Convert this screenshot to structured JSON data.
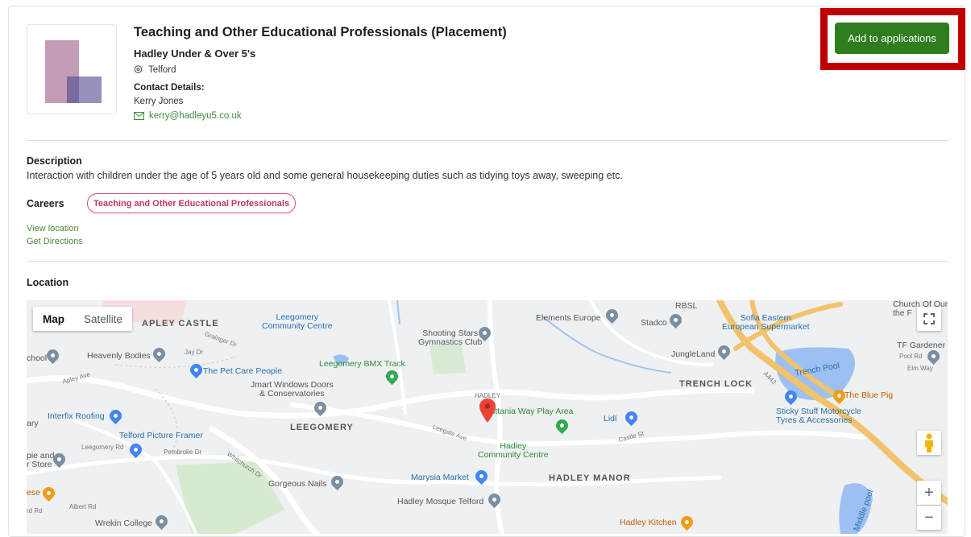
{
  "listing": {
    "title": "Teaching and Other Educational Professionals (Placement)",
    "employer": "Hadley Under & Over 5's",
    "location": "Telford",
    "contact_heading": "Contact Details:",
    "contact_name": "Kerry Jones",
    "contact_email": "kerry@hadleyu5.co.uk"
  },
  "actions": {
    "add_label": "Add to applications"
  },
  "description": {
    "heading": "Description",
    "text": "Interaction with children under the age of 5 years old and some general housekeeping duties such as tidying toys away, sweeping etc."
  },
  "careers": {
    "heading": "Careers",
    "tag": "Teaching and Other Educational Professionals"
  },
  "links": {
    "view_location": "View location",
    "get_directions": "Get Directions"
  },
  "location": {
    "heading": "Location"
  },
  "map": {
    "type_map": "Map",
    "type_satellite": "Satellite",
    "zoom_in": "+",
    "zoom_out": "−",
    "labels": {
      "apley_castle": "APLEY CASTLE",
      "leegomery_cc": "Leegomery\nCommunity Centre",
      "shooting_stars": "Shooting Stars\nGymnastics Club",
      "elements_europe": "Elements Europe",
      "stadco": "Stadco",
      "rbsl": "RBSL",
      "sofia": "Sofia Eastern\nEuropean Supermarket",
      "church": "Church Of Our\nthe F",
      "school": "chool",
      "heavenly": "Heavenly Bodies",
      "jay_dr": "Jay Dr",
      "grainger_dr": "Grainger Dr",
      "pet_care": "The Pet Care People",
      "bmx": "Leegomery BMX Track",
      "jungleland": "JungleLand",
      "tf_gardener": "TF Gardener",
      "pool_rd": "Pool Rd",
      "elm_way": "Elm Way",
      "trench_pool": "Trench Pool",
      "apley_ave": "Apley Ave",
      "jmart": "Jmart Windows Doors\n& Conservatories",
      "hadley": "HADLEY",
      "trench_lock": "TRENCH LOCK",
      "a442": "A442",
      "blue_pig": "The Blue Pig",
      "interfix": "Interfix Roofing",
      "leegomery": "LEEGOMERY",
      "leegate_ave": "Leegate Ave",
      "play_area": "ittania Way Play Area",
      "lidl": "Lidl",
      "castle_st": "Castle St",
      "sticky": "Sticky Stuff Motorcycle\nTyres & Accessories",
      "picture_framer": "Telford Picture Framer",
      "pembroke": "Pembroke Dr",
      "leegomery_rd": "Leegomery Rd",
      "whitchurch": "Whitchurch Dr",
      "hadley_cc": "Hadley\nCommunity Centre",
      "pie_store": "pie and\nr Store",
      "gorgeous": "Gorgeous Nails",
      "marysia": "Marysia Market",
      "hadley_manor": "HADLEY MANOR",
      "middle_pool": "Middle pool",
      "ese": "ese",
      "rd_rd": "rd Rd",
      "albert_rd": "Albert Rd",
      "mosque": "Hadley Mosque Telford",
      "wrekin": "Wrekin College",
      "hadley_kitchen": "Hadley Kitchen",
      "ary": "ary"
    }
  },
  "colors": {
    "accent_green": "#2f7d1e",
    "highlight_red": "#c00000",
    "tag_pink": "#c7365f",
    "link_green": "#4d8a3c"
  }
}
